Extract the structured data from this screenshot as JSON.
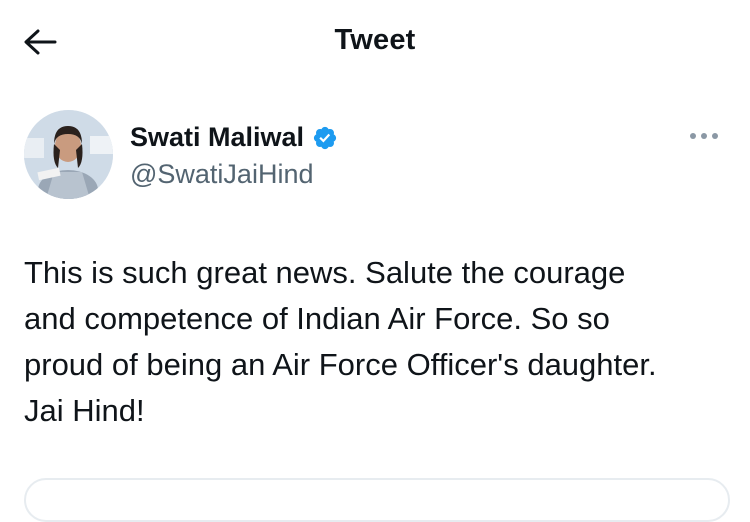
{
  "header": {
    "title": "Tweet",
    "back_icon": "arrow-left-icon"
  },
  "author": {
    "name": "Swati Maliwal",
    "handle": "@SwatiJaiHind",
    "verified": true,
    "verified_color": "#1d9bf0",
    "more_icon": "more-horizontal-icon"
  },
  "tweet": {
    "text": "This is such great news. Salute the courage\nand competence of Indian Air Force. So so\nproud of being an Air Force Officer's daughter.\nJai Hind!"
  },
  "colors": {
    "text_primary": "#0f1419",
    "text_secondary": "#536471",
    "accent": "#1d9bf0"
  }
}
